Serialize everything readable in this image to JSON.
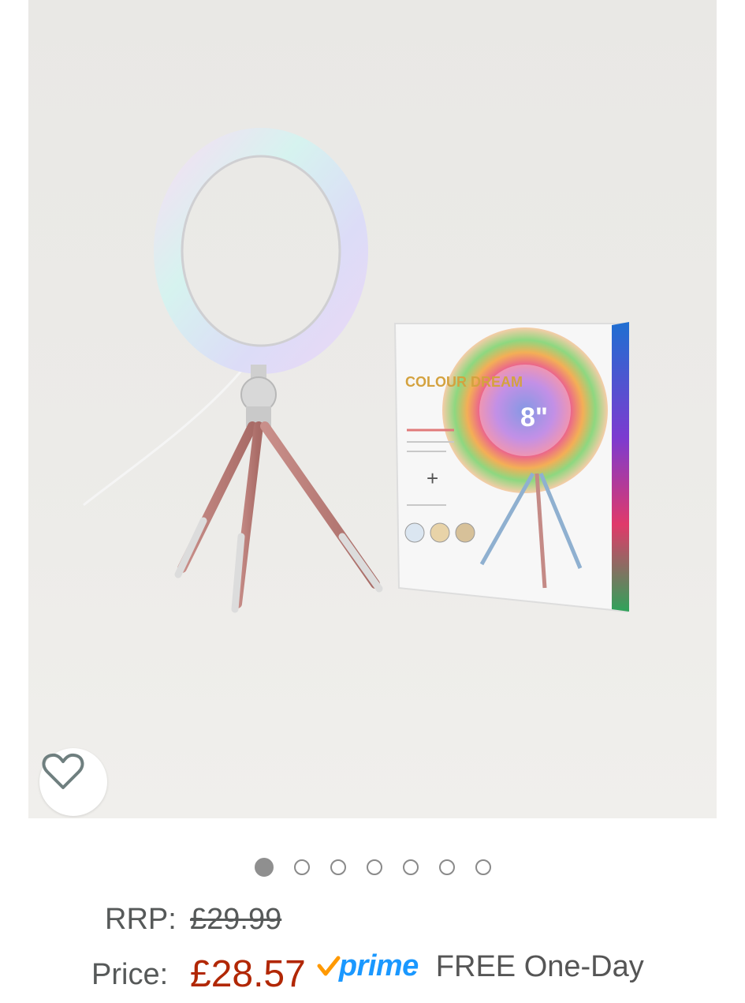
{
  "product": {
    "image_description_icon": "ring-light-product-photo",
    "box_size_text": "8\"",
    "box_brand_text": "COLOUR DREAM",
    "box_plus_text": "+"
  },
  "wishlist": {
    "icon": "heart-outline-icon"
  },
  "carousel": {
    "total": 7,
    "active_index": 0
  },
  "pricing": {
    "rrp_label": "RRP:",
    "rrp_value": "£29.99",
    "price_label": "Price:",
    "price_value": "£28.57",
    "prime_label": "prime",
    "delivery_text": "FREE One-Day"
  },
  "colors": {
    "price": "#b12704",
    "prime": "#1a98ff",
    "prime_check": "#ff9900",
    "muted_text": "#565959"
  }
}
